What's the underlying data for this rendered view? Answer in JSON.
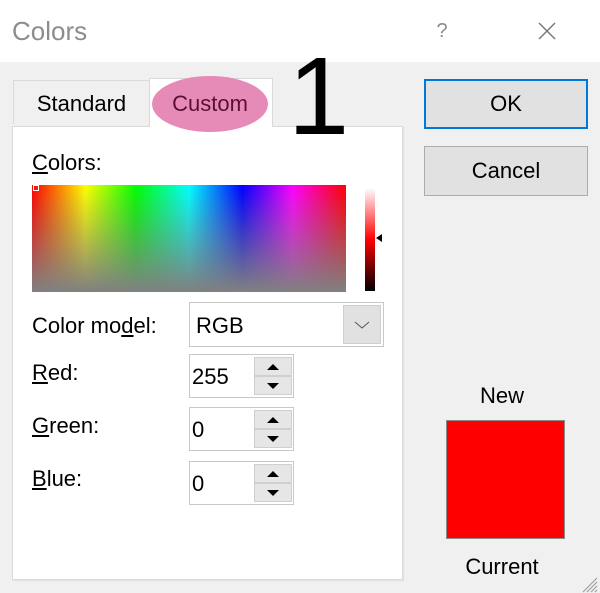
{
  "window": {
    "title": "Colors",
    "help_label": "?",
    "close_icon": "close-x-icon"
  },
  "tabs": [
    {
      "label": "Standard",
      "active": false
    },
    {
      "label": "Custom",
      "active": true,
      "highlighted": true
    }
  ],
  "annotation": {
    "number": "1",
    "highlight_color": "#e68bb8"
  },
  "custom": {
    "colors_label": {
      "accel": "C",
      "rest": "olors:"
    },
    "color_model": {
      "label_pre": "Color mo",
      "label_accel": "d",
      "label_post": "el:",
      "value": "RGB"
    },
    "red": {
      "accel": "R",
      "rest": "ed:",
      "value": "255"
    },
    "green": {
      "accel": "G",
      "rest": "reen:",
      "value": "0"
    },
    "blue": {
      "accel": "B",
      "rest": "lue:",
      "value": "0"
    }
  },
  "buttons": {
    "ok": "OK",
    "cancel": "Cancel"
  },
  "preview": {
    "new_label": "New",
    "current_label": "Current",
    "new_color": "#ff0000",
    "current_color": "#ff0000"
  },
  "colors": {
    "focus_border": "#0078d7",
    "background": "#f0f0f0"
  }
}
